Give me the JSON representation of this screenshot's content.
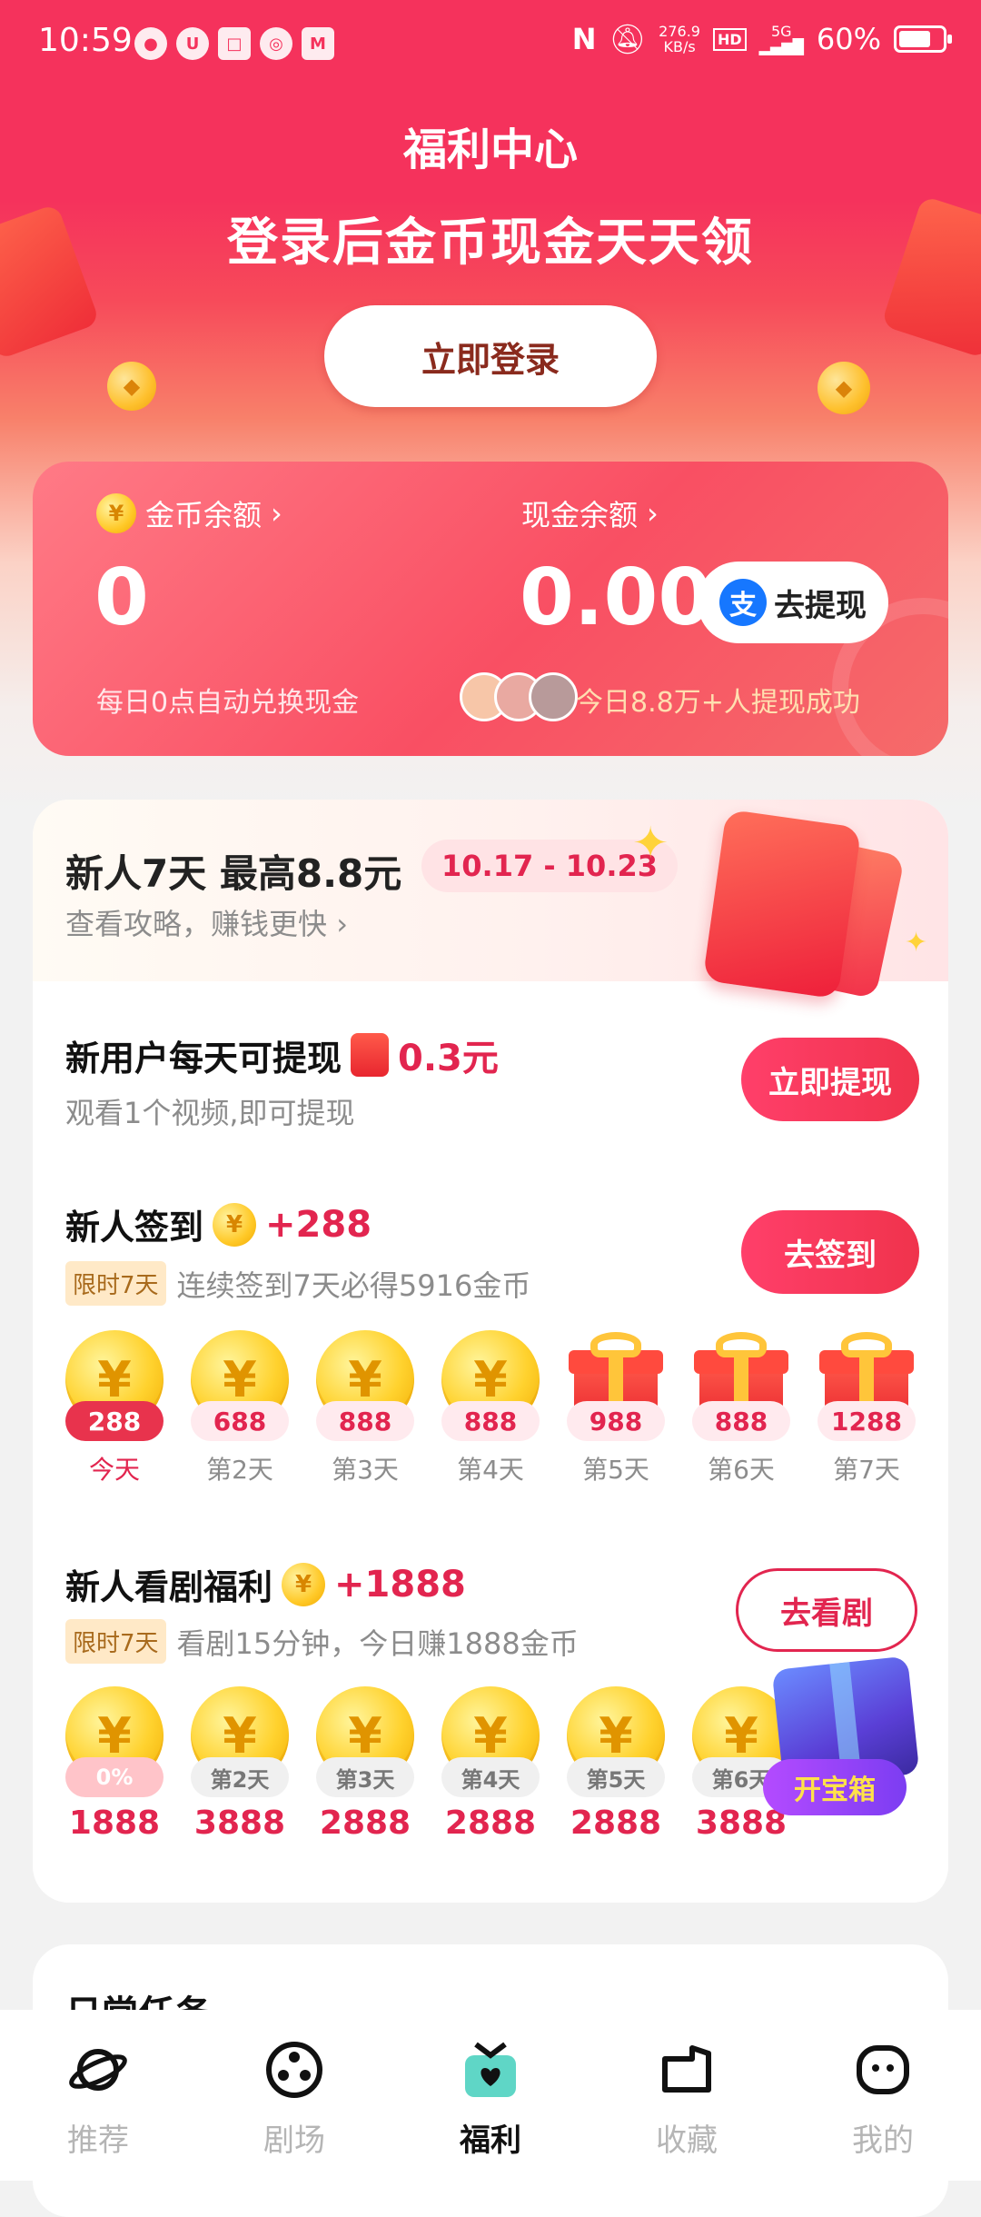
{
  "status_bar": {
    "time": "10:59",
    "net_speed": "276.9",
    "net_unit": "KB/s",
    "hd": "HD",
    "network": "5G",
    "battery": "60%"
  },
  "header": {
    "title": "福利中心"
  },
  "hero": {
    "headline": "登录后金币现金天天领",
    "login_button": "立即登录"
  },
  "balance": {
    "coin_label": "金币余额",
    "coin_value": "0",
    "coin_note": "每日0点自动兑换现金",
    "cash_label": "现金余额",
    "cash_value": "0.00",
    "withdraw_button": "去提现",
    "withdraw_note": "今日8.8万+人提现成功"
  },
  "banner": {
    "title": "新人7天 最高8.8元",
    "date_range": "10.17 - 10.23",
    "subtitle": "查看攻略，赚钱更快"
  },
  "new_user_withdraw": {
    "title": "新用户每天可提现",
    "amount": "0.3元",
    "subtitle": "观看1个视频,即可提现",
    "button": "立即提现"
  },
  "signin": {
    "title": "新人签到",
    "bonus": "+288",
    "tag": "限时7天",
    "subtitle": "连续签到7天必得5916金币",
    "button": "去签到",
    "days": [
      {
        "reward": "288",
        "label": "今天",
        "kind": "coin",
        "state": "active"
      },
      {
        "reward": "688",
        "label": "第2天",
        "kind": "coin",
        "state": "pending"
      },
      {
        "reward": "888",
        "label": "第3天",
        "kind": "coin",
        "state": "pending"
      },
      {
        "reward": "888",
        "label": "第4天",
        "kind": "coin",
        "state": "pending"
      },
      {
        "reward": "988",
        "label": "第5天",
        "kind": "gift",
        "state": "pending"
      },
      {
        "reward": "888",
        "label": "第6天",
        "kind": "gift",
        "state": "pending"
      },
      {
        "reward": "1288",
        "label": "第7天",
        "kind": "gift",
        "state": "pending"
      }
    ]
  },
  "watch": {
    "title": "新人看剧福利",
    "bonus": "+1888",
    "tag": "限时7天",
    "subtitle": "看剧15分钟，今日赚1888金币",
    "button": "去看剧",
    "days": [
      {
        "progress": "0%",
        "amount": "1888"
      },
      {
        "progress": "第2天",
        "amount": "3888"
      },
      {
        "progress": "第3天",
        "amount": "2888"
      },
      {
        "progress": "第4天",
        "amount": "2888"
      },
      {
        "progress": "第5天",
        "amount": "2888"
      },
      {
        "progress": "第6天",
        "amount": "3888"
      }
    ],
    "treasure_label": "开宝箱"
  },
  "daily": {
    "title": "日常任务"
  },
  "nav": {
    "items": [
      {
        "label": "推荐",
        "icon": "planet-icon",
        "active": false
      },
      {
        "label": "剧场",
        "icon": "film-reel-icon",
        "active": false
      },
      {
        "label": "福利",
        "icon": "gift-heart-icon",
        "active": true
      },
      {
        "label": "收藏",
        "icon": "folder-icon",
        "active": false
      },
      {
        "label": "我的",
        "icon": "face-icon",
        "active": false
      }
    ]
  },
  "colors": {
    "brand": "#f5325c",
    "accent_text": "#e2254f",
    "coin": "#ffc928",
    "nav_inactive": "#b5b5b5"
  }
}
